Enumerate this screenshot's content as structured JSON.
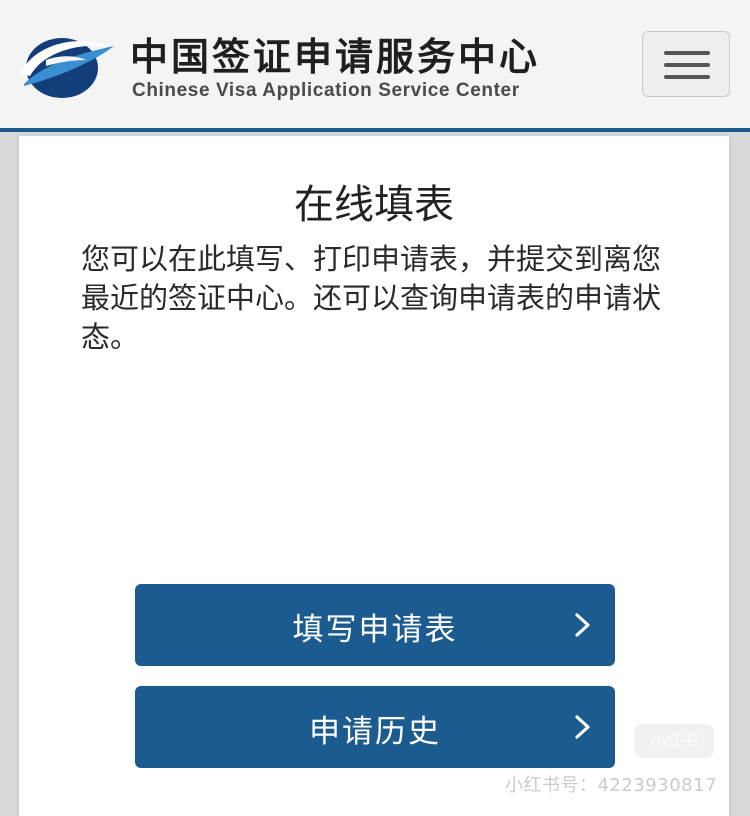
{
  "header": {
    "brand_cn": "中国签证申请服务中心",
    "brand_en": "Chinese Visa Application Service Center",
    "logo_icon": "globe-swoosh-icon",
    "menu_icon": "hamburger-menu-icon",
    "accent_color": "#1d5a8e"
  },
  "main": {
    "title": "在线填表",
    "intro": "您可以在此填写、打印申请表，并提交到离您最近的签证中心。还可以查询申请表的申请状态。",
    "buttons": [
      {
        "label": "填写申请表",
        "icon": "chevron-right-icon"
      },
      {
        "label": "申请历史",
        "icon": "chevron-right-icon"
      }
    ],
    "button_color": "#1b5b8f"
  },
  "watermark": {
    "badge": "小红书",
    "text": "小红书号：4223930817"
  }
}
